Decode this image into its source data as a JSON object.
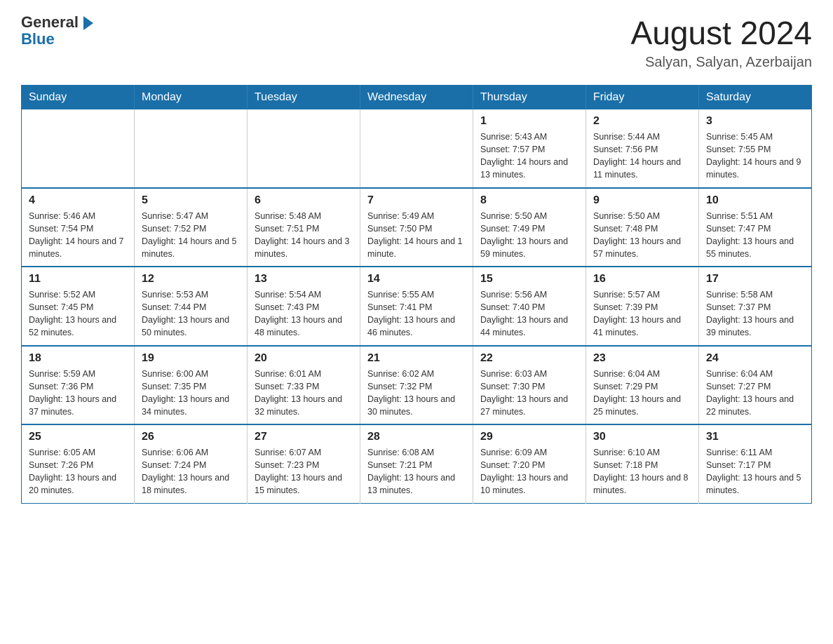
{
  "header": {
    "logo_general": "General",
    "logo_blue": "Blue",
    "month_year": "August 2024",
    "location": "Salyan, Salyan, Azerbaijan"
  },
  "weekdays": [
    "Sunday",
    "Monday",
    "Tuesday",
    "Wednesday",
    "Thursday",
    "Friday",
    "Saturday"
  ],
  "weeks": [
    [
      {
        "day": "",
        "info": ""
      },
      {
        "day": "",
        "info": ""
      },
      {
        "day": "",
        "info": ""
      },
      {
        "day": "",
        "info": ""
      },
      {
        "day": "1",
        "info": "Sunrise: 5:43 AM\nSunset: 7:57 PM\nDaylight: 14 hours and 13 minutes."
      },
      {
        "day": "2",
        "info": "Sunrise: 5:44 AM\nSunset: 7:56 PM\nDaylight: 14 hours and 11 minutes."
      },
      {
        "day": "3",
        "info": "Sunrise: 5:45 AM\nSunset: 7:55 PM\nDaylight: 14 hours and 9 minutes."
      }
    ],
    [
      {
        "day": "4",
        "info": "Sunrise: 5:46 AM\nSunset: 7:54 PM\nDaylight: 14 hours and 7 minutes."
      },
      {
        "day": "5",
        "info": "Sunrise: 5:47 AM\nSunset: 7:52 PM\nDaylight: 14 hours and 5 minutes."
      },
      {
        "day": "6",
        "info": "Sunrise: 5:48 AM\nSunset: 7:51 PM\nDaylight: 14 hours and 3 minutes."
      },
      {
        "day": "7",
        "info": "Sunrise: 5:49 AM\nSunset: 7:50 PM\nDaylight: 14 hours and 1 minute."
      },
      {
        "day": "8",
        "info": "Sunrise: 5:50 AM\nSunset: 7:49 PM\nDaylight: 13 hours and 59 minutes."
      },
      {
        "day": "9",
        "info": "Sunrise: 5:50 AM\nSunset: 7:48 PM\nDaylight: 13 hours and 57 minutes."
      },
      {
        "day": "10",
        "info": "Sunrise: 5:51 AM\nSunset: 7:47 PM\nDaylight: 13 hours and 55 minutes."
      }
    ],
    [
      {
        "day": "11",
        "info": "Sunrise: 5:52 AM\nSunset: 7:45 PM\nDaylight: 13 hours and 52 minutes."
      },
      {
        "day": "12",
        "info": "Sunrise: 5:53 AM\nSunset: 7:44 PM\nDaylight: 13 hours and 50 minutes."
      },
      {
        "day": "13",
        "info": "Sunrise: 5:54 AM\nSunset: 7:43 PM\nDaylight: 13 hours and 48 minutes."
      },
      {
        "day": "14",
        "info": "Sunrise: 5:55 AM\nSunset: 7:41 PM\nDaylight: 13 hours and 46 minutes."
      },
      {
        "day": "15",
        "info": "Sunrise: 5:56 AM\nSunset: 7:40 PM\nDaylight: 13 hours and 44 minutes."
      },
      {
        "day": "16",
        "info": "Sunrise: 5:57 AM\nSunset: 7:39 PM\nDaylight: 13 hours and 41 minutes."
      },
      {
        "day": "17",
        "info": "Sunrise: 5:58 AM\nSunset: 7:37 PM\nDaylight: 13 hours and 39 minutes."
      }
    ],
    [
      {
        "day": "18",
        "info": "Sunrise: 5:59 AM\nSunset: 7:36 PM\nDaylight: 13 hours and 37 minutes."
      },
      {
        "day": "19",
        "info": "Sunrise: 6:00 AM\nSunset: 7:35 PM\nDaylight: 13 hours and 34 minutes."
      },
      {
        "day": "20",
        "info": "Sunrise: 6:01 AM\nSunset: 7:33 PM\nDaylight: 13 hours and 32 minutes."
      },
      {
        "day": "21",
        "info": "Sunrise: 6:02 AM\nSunset: 7:32 PM\nDaylight: 13 hours and 30 minutes."
      },
      {
        "day": "22",
        "info": "Sunrise: 6:03 AM\nSunset: 7:30 PM\nDaylight: 13 hours and 27 minutes."
      },
      {
        "day": "23",
        "info": "Sunrise: 6:04 AM\nSunset: 7:29 PM\nDaylight: 13 hours and 25 minutes."
      },
      {
        "day": "24",
        "info": "Sunrise: 6:04 AM\nSunset: 7:27 PM\nDaylight: 13 hours and 22 minutes."
      }
    ],
    [
      {
        "day": "25",
        "info": "Sunrise: 6:05 AM\nSunset: 7:26 PM\nDaylight: 13 hours and 20 minutes."
      },
      {
        "day": "26",
        "info": "Sunrise: 6:06 AM\nSunset: 7:24 PM\nDaylight: 13 hours and 18 minutes."
      },
      {
        "day": "27",
        "info": "Sunrise: 6:07 AM\nSunset: 7:23 PM\nDaylight: 13 hours and 15 minutes."
      },
      {
        "day": "28",
        "info": "Sunrise: 6:08 AM\nSunset: 7:21 PM\nDaylight: 13 hours and 13 minutes."
      },
      {
        "day": "29",
        "info": "Sunrise: 6:09 AM\nSunset: 7:20 PM\nDaylight: 13 hours and 10 minutes."
      },
      {
        "day": "30",
        "info": "Sunrise: 6:10 AM\nSunset: 7:18 PM\nDaylight: 13 hours and 8 minutes."
      },
      {
        "day": "31",
        "info": "Sunrise: 6:11 AM\nSunset: 7:17 PM\nDaylight: 13 hours and 5 minutes."
      }
    ]
  ]
}
